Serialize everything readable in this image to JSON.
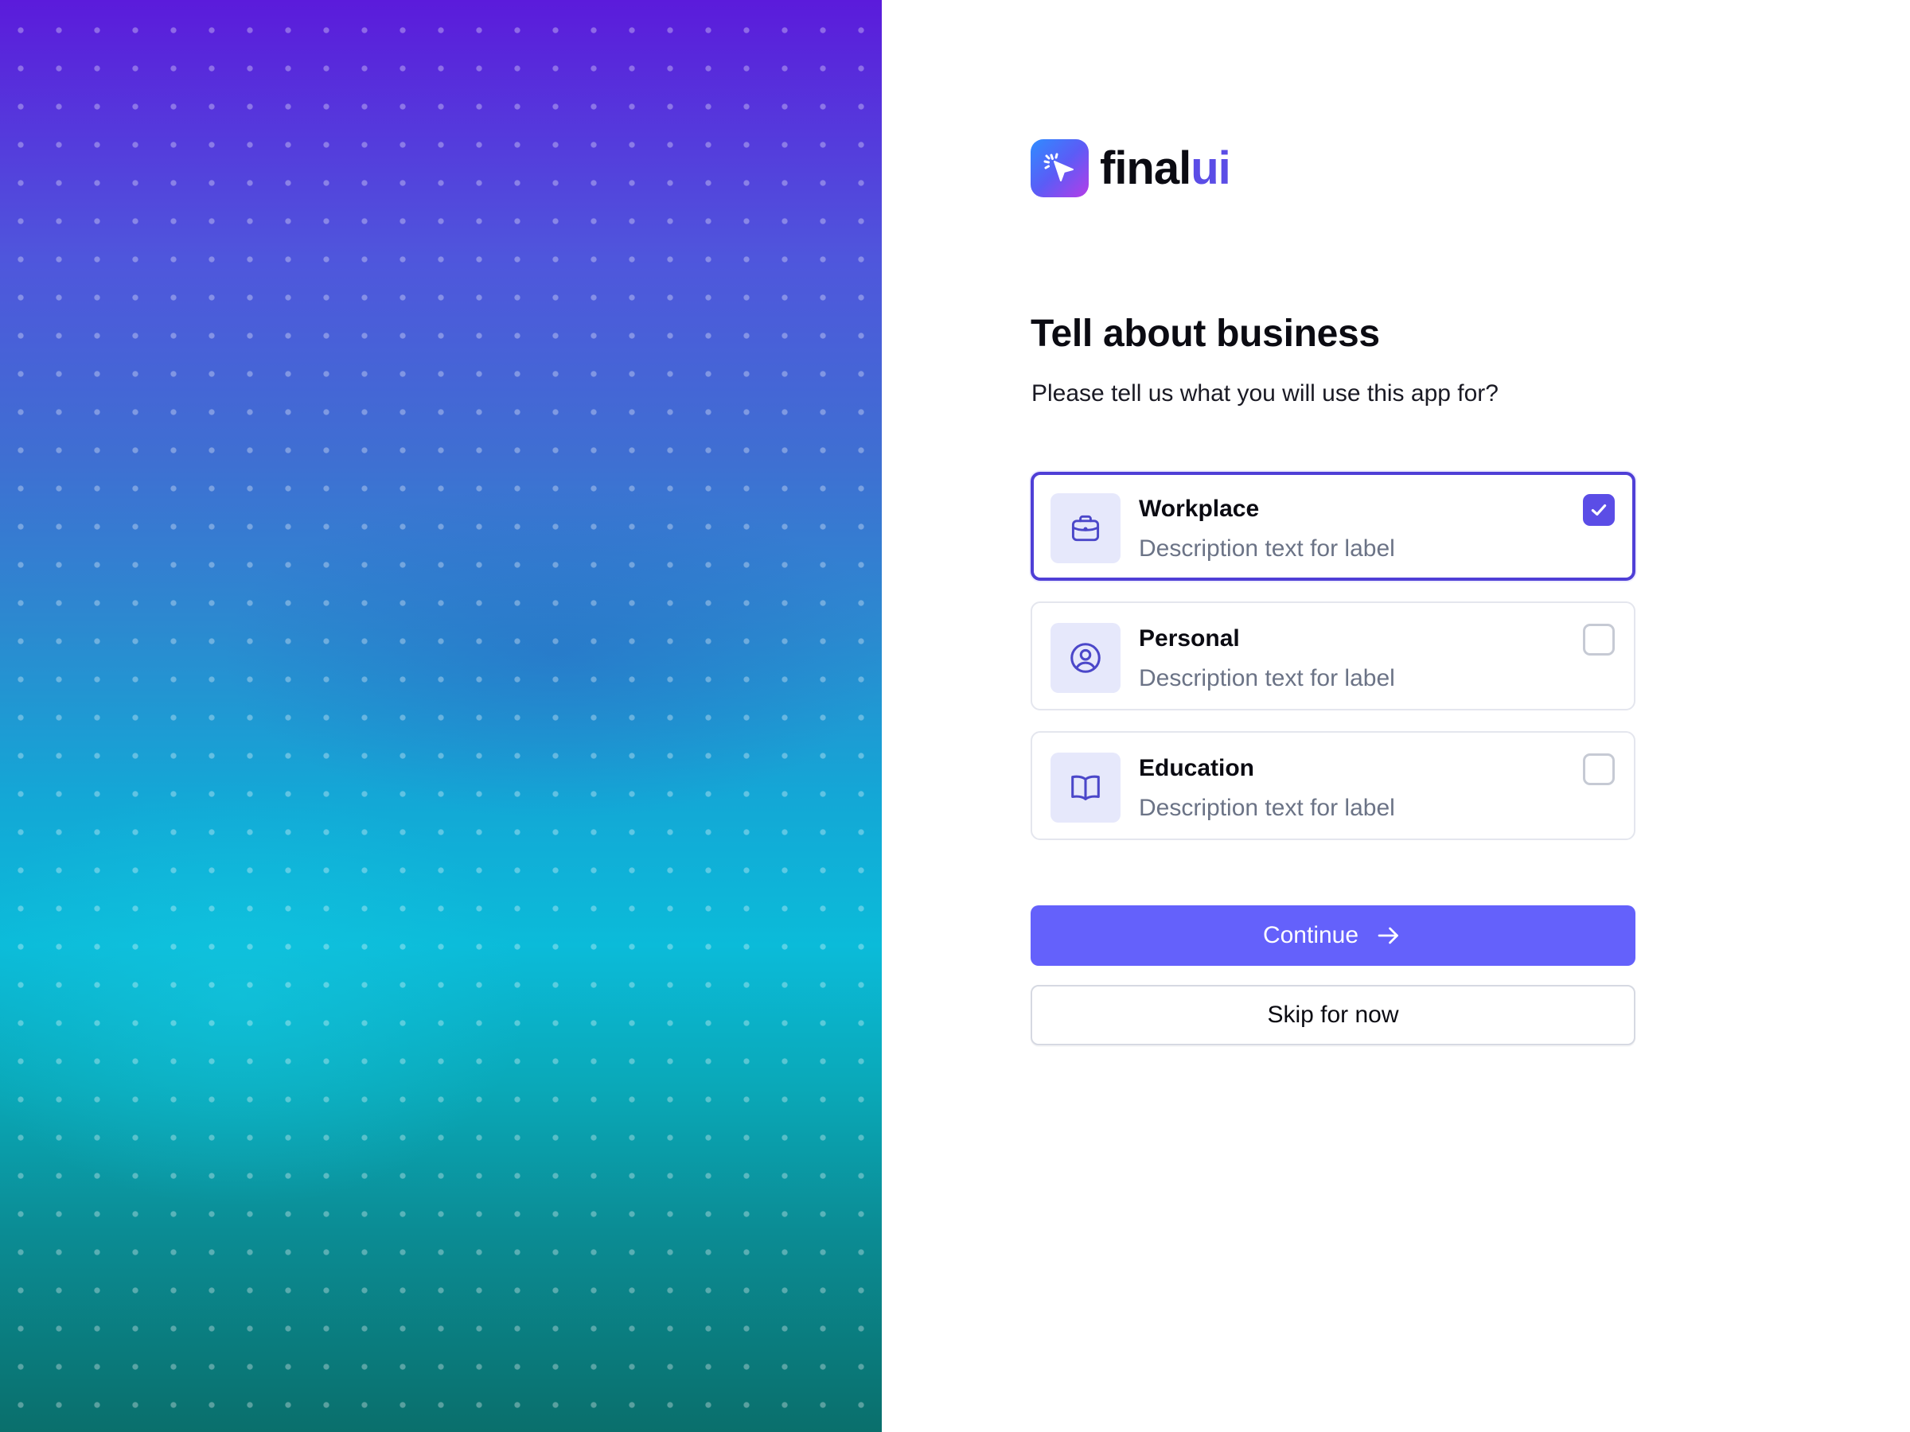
{
  "brand": {
    "name_main": "final",
    "name_accent": "ui",
    "logo_icon": "cursor-sparkle-icon"
  },
  "page": {
    "title": "Tell about business",
    "subtitle": "Please tell us what you will use this app for?"
  },
  "options": [
    {
      "title": "Workplace",
      "description": "Description text for label",
      "icon": "briefcase-icon",
      "checked": true
    },
    {
      "title": "Personal",
      "description": "Description text for label",
      "icon": "user-circle-icon",
      "checked": false
    },
    {
      "title": "Education",
      "description": "Description text for label",
      "icon": "book-open-icon",
      "checked": false
    }
  ],
  "actions": {
    "continue_label": "Continue",
    "continue_icon": "arrow-right-icon",
    "skip_label": "Skip for now"
  },
  "colors": {
    "accent": "#6461fb",
    "selected_border": "#4f3fd6",
    "checkbox_checked": "#5b4de6",
    "icon_tile": "#e6e8fb",
    "icon_stroke": "#4b47c9",
    "description_text": "#6b7386"
  }
}
